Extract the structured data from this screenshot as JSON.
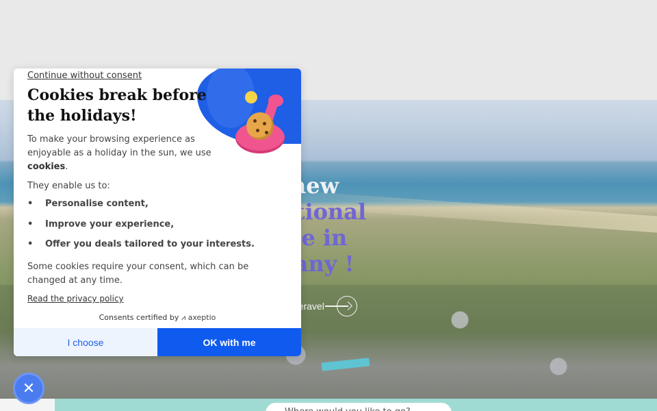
{
  "hero": {
    "title_line1": "A new",
    "title_line2": "eptional",
    "title_line3": "lace in",
    "title_line4": "ittany !",
    "link_label": "er Keravel"
  },
  "search": {
    "placeholder": "Where would you like to go?"
  },
  "cookie_modal": {
    "continue_label": "Continue without consent",
    "title": "Cookies break before the holidays!",
    "intro_text": "To make your browsing experience as enjoyable as a holiday in the sun, we use",
    "intro_bold": "cookies",
    "intro_end": ".",
    "enable_text": "They enable us to:",
    "bullets": [
      "Personalise content,",
      "Improve your experience,",
      "Offer you deals tailored to your interests."
    ],
    "consent_note": "Some cookies require your consent, which can be changed at any time.",
    "privacy_label": "Read the privacy policy",
    "certified_label": "Consents certified by",
    "certified_brand": "axeptio",
    "choose_label": "I choose",
    "ok_label": "OK with me"
  },
  "close_fab": {
    "icon": "close-icon",
    "glyph": "✕"
  },
  "colors": {
    "accent": "#0f5bf0",
    "accent_light": "#edf4fd",
    "hero_title": "#6f66d6",
    "flamingo": "#f1558f"
  }
}
